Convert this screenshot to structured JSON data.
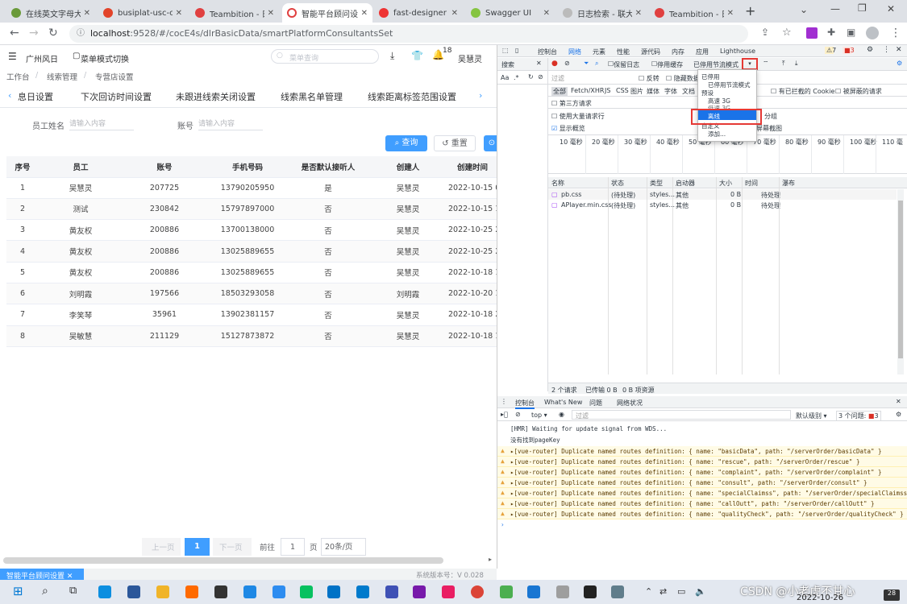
{
  "browser": {
    "tabs": [
      {
        "title": "在线英文字母大"
      },
      {
        "title": "busiplat-usc-c"
      },
      {
        "title": "Teambition - 日"
      },
      {
        "title": "智能平台顾问设"
      },
      {
        "title": "fast-designer"
      },
      {
        "title": "Swagger UI"
      },
      {
        "title": "日志检索 - 联大"
      },
      {
        "title": "Teambition - 日"
      }
    ],
    "url_host": "localhost",
    "url_rest": ":9528/#/cocE4s/dlrBasicData/smartPlatformConsultantsSet",
    "new_tab": "+"
  },
  "app": {
    "store": "广州风日",
    "menu_mode": "菜单模式切换",
    "menu_search_placeholder": "菜单查询",
    "notif_count": "18",
    "user": "吴慧灵",
    "breadcrumb": [
      "工作台",
      "线索管理",
      "专营店设置"
    ],
    "tabs": [
      "息日设置",
      "下次回访时间设置",
      "未跟进线索关闭设置",
      "线索黑名单管理",
      "线索距离标签范围设置"
    ],
    "form": {
      "name_label": "员工姓名",
      "name_placeholder": "请输入内容",
      "account_label": "账号",
      "account_placeholder": "请输入内容",
      "query_btn": "查询",
      "reset_btn": "重置"
    },
    "columns": [
      "序号",
      "员工",
      "账号",
      "手机号码",
      "是否默认接听人",
      "创建人",
      "创建时间"
    ],
    "rows": [
      [
        "1",
        "吴慧灵",
        "207725",
        "13790205950",
        "是",
        "吴慧灵",
        "2022-10-15 0"
      ],
      [
        "2",
        "测试",
        "230842",
        "15797897000",
        "否",
        "吴慧灵",
        "2022-10-15 1"
      ],
      [
        "3",
        "黄友权",
        "200886",
        "13700138000",
        "否",
        "吴慧灵",
        "2022-10-25 2"
      ],
      [
        "4",
        "黄友权",
        "200886",
        "13025889655",
        "否",
        "吴慧灵",
        "2022-10-25 2"
      ],
      [
        "5",
        "黄友权",
        "200886",
        "13025889655",
        "否",
        "吴慧灵",
        "2022-10-18 1"
      ],
      [
        "6",
        "刘明霞",
        "197566",
        "18503293058",
        "否",
        "刘明霞",
        "2022-10-20 1"
      ],
      [
        "7",
        "李笑琴",
        "35961",
        "13902381157",
        "否",
        "吴慧灵",
        "2022-10-18 2"
      ],
      [
        "8",
        "吴敏慧",
        "211129",
        "15127873872",
        "否",
        "吴慧灵",
        "2022-10-18 1"
      ]
    ],
    "pager": {
      "prev": "上一页",
      "current": "1",
      "next": "下一页",
      "goto": "前往",
      "goto_value": "1",
      "page_unit": "页",
      "page_size": "20条/页"
    },
    "status_tab": "智能平台顾问设置",
    "version": "系统版本号：V 0.028"
  },
  "devtools": {
    "tabs": [
      "控制台",
      "网络",
      "元素",
      "性能",
      "源代码",
      "内存",
      "应用",
      "Lighthouse"
    ],
    "warn_count": "7",
    "err_count": "3",
    "search_label": "搜索",
    "preserve_log": "保留日志",
    "disable_cache": "停用缓存",
    "throttle": "已停用节流模式",
    "filter_placeholder": "过滤",
    "invert": "反转",
    "hide_data_urls": "隐藏数据",
    "types": [
      "全部",
      "Fetch/XHR",
      "JS",
      "CSS",
      "图片",
      "媒体",
      "字体",
      "文档"
    ],
    "blocked_cookies": "有已拦截的 Cookie",
    "blocked_requests": "被屏蔽的请求",
    "third_party": "第三方请求",
    "large_rows": "使用大量请求行",
    "show_overview": "显示概览",
    "group_frame": "分组",
    "screenshots": "屏幕截图",
    "dropdown": {
      "disabled_head": "已停用",
      "disabled_item": "已停用节流模式",
      "preset_head": "预设",
      "fast3g": "高速 3G",
      "slow3g": "低速 3G",
      "offline": "离线",
      "custom_head": "自定义",
      "add": "添加..."
    },
    "timeline": [
      "10 毫秒",
      "20 毫秒",
      "30 毫秒",
      "40 毫秒",
      "50 毫秒",
      "60 毫秒",
      "70 毫秒",
      "80 毫秒",
      "90 毫秒",
      "100 毫秒",
      "110 毫"
    ],
    "net_columns": [
      "名称",
      "状态",
      "类型",
      "启动器",
      "大小",
      "时间",
      "瀑布"
    ],
    "net_rows": [
      [
        "pb.css",
        "(待处理)",
        "styles...",
        "其他",
        "0 B",
        "待处理"
      ],
      [
        "APlayer.min.css",
        "(待处理)",
        "styles...",
        "其他",
        "0 B",
        "待处理"
      ]
    ],
    "net_summary": [
      "2 个请求",
      "已传输 0 B",
      "0 B 项资源"
    ],
    "drawer_tabs": [
      "控制台",
      "What's New",
      "问题",
      "网络状况"
    ],
    "console_context": "top",
    "console_filter": "过滤",
    "log_level": "默认级别",
    "issues": "3 个问题:",
    "issues_count": "3",
    "logs": [
      "[HMR] Waiting for update signal from WDS...",
      "没有找到pageKey"
    ],
    "warnings": [
      "▸[vue-router] Duplicate named routes definition: { name: \"basicData\", path: \"/serverOrder/basicData\" }",
      "▸[vue-router] Duplicate named routes definition: { name: \"rescue\", path: \"/serverOrder/rescue\" }",
      "▸[vue-router] Duplicate named routes definition: { name: \"complaint\", path: \"/serverOrder/complaint\" }",
      "▸[vue-router] Duplicate named routes definition: { name: \"consult\", path: \"/serverOrder/consult\" }",
      "▸[vue-router] Duplicate named routes definition: { name: \"specialClaimss\", path: \"/serverOrder/specialClaimss\" }",
      "▸[vue-router] Duplicate named routes definition: { name: \"callOutt\", path: \"/serverOrder/callOutt\" }",
      "▸[vue-router] Duplicate named routes definition: { name: \"qualityCheck\", path: \"/serverOrder/qualityCheck\" }"
    ]
  },
  "taskbar": {
    "watermark": "CSDN @小老虎不甘心",
    "date": "2022-10-26"
  },
  "colors": {
    "primary": "#409eff",
    "highlight_red": "#e53935",
    "warn_bg": "#fffbe6"
  }
}
